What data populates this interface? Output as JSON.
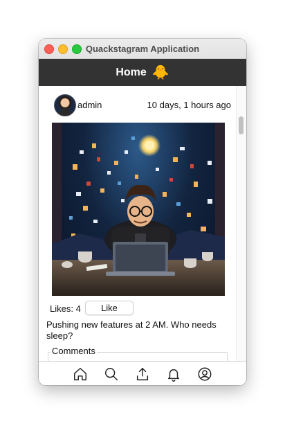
{
  "window": {
    "title": "Quackstagram Application"
  },
  "header": {
    "title": "Home",
    "icon": "duck-icon",
    "emoji": "🐥"
  },
  "post": {
    "username": "admin",
    "timestamp": "10 days, 1 hours ago",
    "image_description_icon": "post-image",
    "likes_label": "Likes: 4",
    "like_button_label": "Like",
    "caption": "Pushing new features at 2 AM. Who needs sleep?",
    "comments_label": "Comments"
  },
  "bottom_nav": [
    {
      "name": "home-icon"
    },
    {
      "name": "search-icon"
    },
    {
      "name": "upload-icon"
    },
    {
      "name": "notifications-icon"
    },
    {
      "name": "profile-icon"
    }
  ],
  "colors": {
    "header_bg": "#333333",
    "header_text": "#ffffff",
    "traffic_red": "#fe5f57",
    "traffic_yellow": "#febc2e",
    "traffic_green": "#28c840"
  }
}
